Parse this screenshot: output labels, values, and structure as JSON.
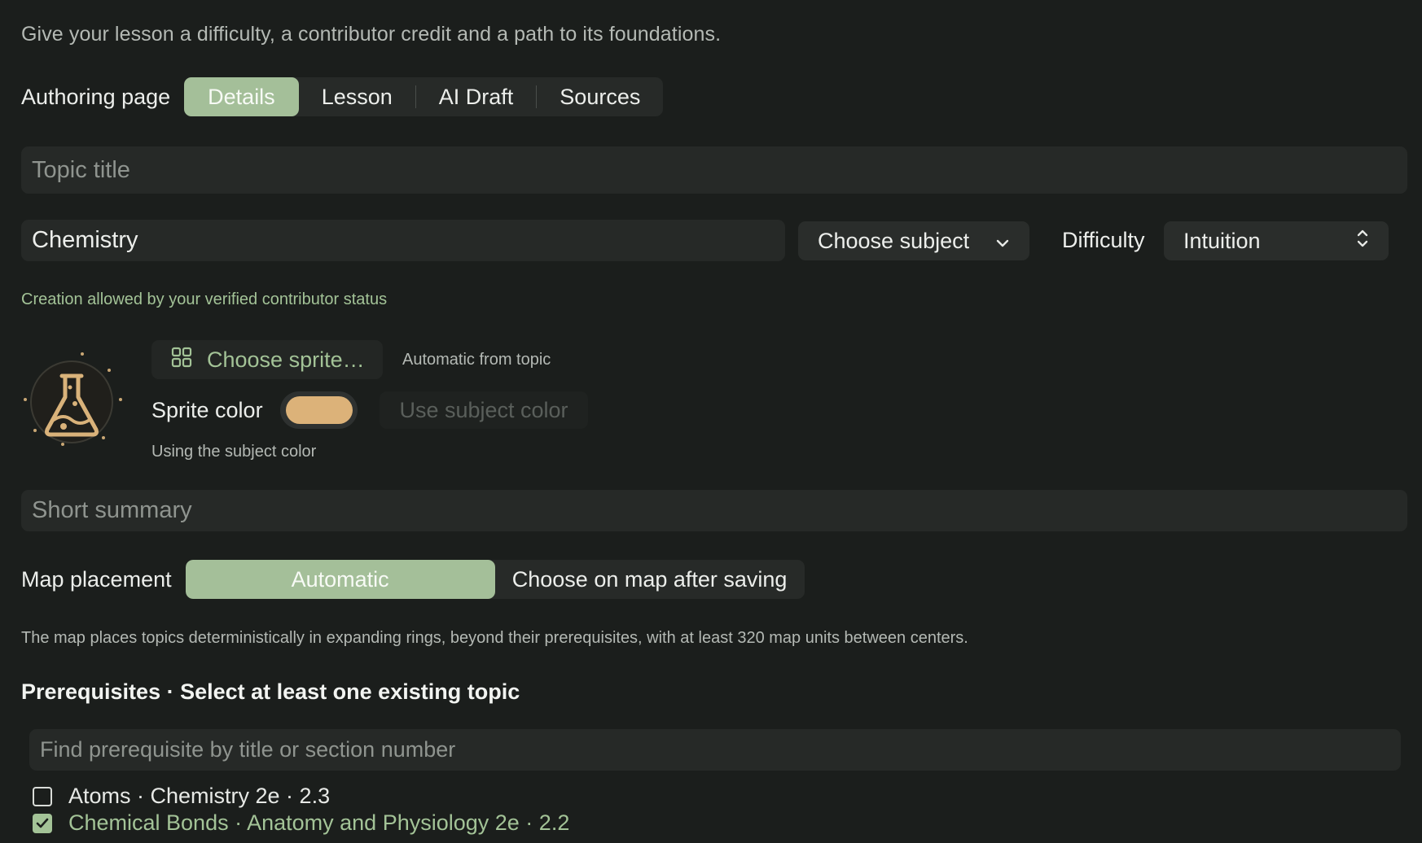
{
  "intro": "Give your lesson a difficulty, a contributor credit and a path to its foundations.",
  "authoring": {
    "label": "Authoring page",
    "tabs": [
      {
        "label": "Details",
        "active": true
      },
      {
        "label": "Lesson",
        "active": false
      },
      {
        "label": "AI Draft",
        "active": false
      },
      {
        "label": "Sources",
        "active": false
      }
    ]
  },
  "topic_title": {
    "placeholder": "Topic title",
    "value": ""
  },
  "subject_field": {
    "value": "Chemistry"
  },
  "subject_select": {
    "label": "Choose subject"
  },
  "difficulty": {
    "label": "Difficulty",
    "value": "Intuition"
  },
  "contributor_note": "Creation allowed by your verified contributor status",
  "sprite": {
    "icon": "flask-icon",
    "choose_label": "Choose sprite…",
    "auto_note": "Automatic from topic",
    "color_label": "Sprite color",
    "color": "#dcb279",
    "use_subject_label": "Use subject color",
    "using_note": "Using the subject color"
  },
  "summary": {
    "placeholder": "Short summary",
    "value": ""
  },
  "map_placement": {
    "label": "Map placement",
    "options": [
      {
        "label": "Automatic",
        "active": true
      },
      {
        "label": "Choose on map after saving",
        "active": false
      }
    ],
    "note": "The map places topics deterministically in expanding rings, beyond their prerequisites, with at least 320 map units between centers."
  },
  "prerequisites": {
    "heading": "Prerequisites · Select at least one existing topic",
    "search_placeholder": "Find prerequisite by title or section number",
    "items": [
      {
        "label": "Atoms · Chemistry 2e · 2.3",
        "checked": false
      },
      {
        "label": "Chemical Bonds · Anatomy and Physiology 2e · 2.2",
        "checked": true
      }
    ]
  },
  "colors": {
    "background": "#1b1e1c",
    "accent_green": "#a3c397",
    "active_segment": "#a4bf99",
    "sprite_color": "#dcb279"
  }
}
